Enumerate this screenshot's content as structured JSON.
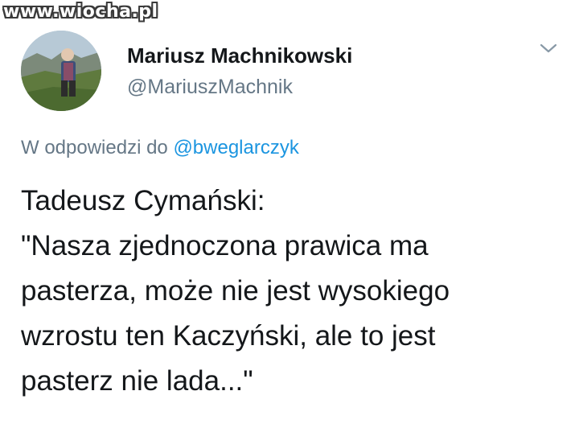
{
  "watermark": "www.wiocha.pl",
  "author": {
    "name": "Mariusz Machnikowski",
    "handle": "@MariuszMachnik"
  },
  "reply": {
    "prefix": "W odpowiedzi do",
    "handle": "@bweglarczyk"
  },
  "tweet": {
    "lines": [
      "Tadeusz Cymański:",
      "\"Nasza zjednoczona prawica ma",
      "pasterza, może nie jest wysokiego",
      "wzrostu ten Kaczyński, ale to jest",
      "pasterz nie lada...\""
    ]
  },
  "colors": {
    "text": "#14171a",
    "secondary": "#657786",
    "link": "#1b95e0"
  },
  "icons": {
    "menu": "chevron-down-icon"
  }
}
